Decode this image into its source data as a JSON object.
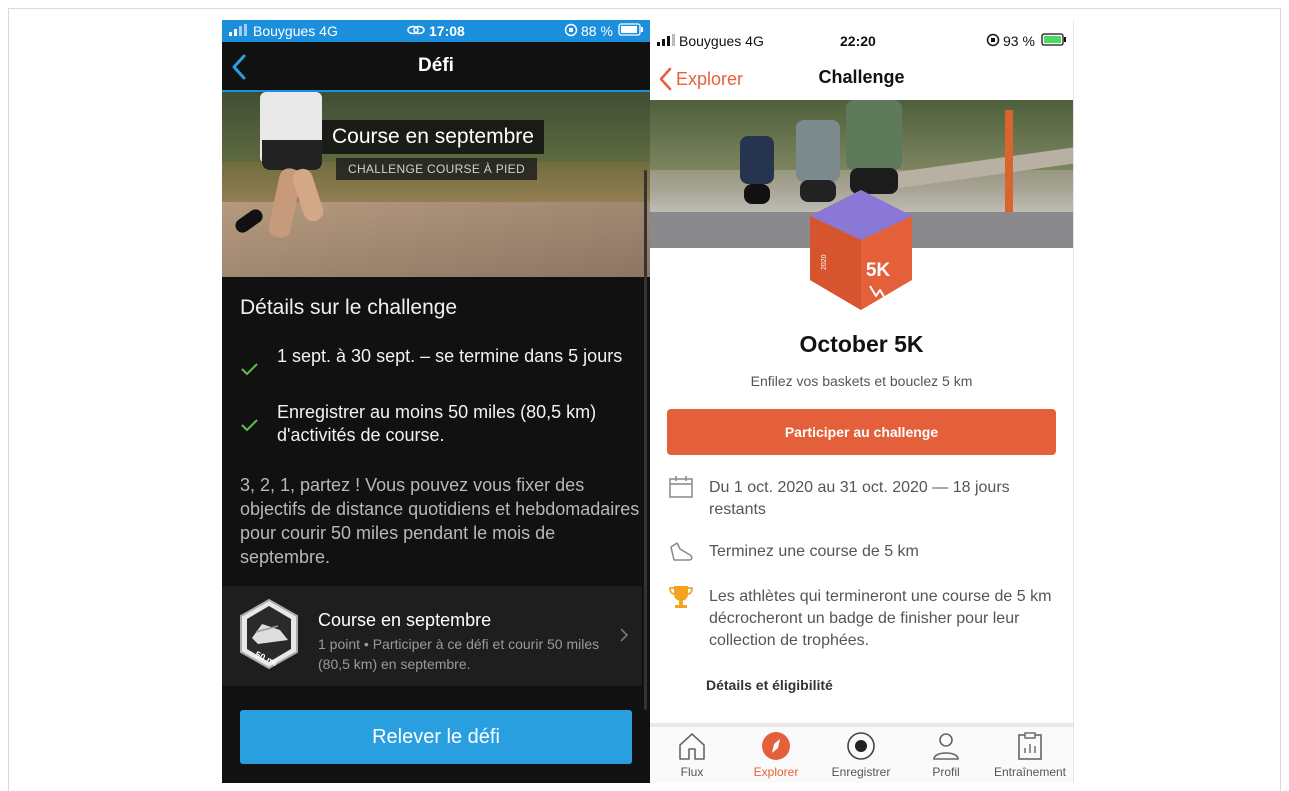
{
  "left_app": {
    "status": {
      "carrier": "Bouygues 4G",
      "time": "17:08",
      "battery": "88 %"
    },
    "header": {
      "title": "Défi",
      "back_icon": "chevron-left-icon"
    },
    "hero": {
      "title": "Course en septembre",
      "tag": "CHALLENGE COURSE À PIED"
    },
    "details_title": "Détails sur le challenge",
    "details_items": [
      {
        "text": "1 sept. à 30 sept. – se termine dans 5 jours",
        "icon": "check-icon"
      },
      {
        "text": "Enregistrer au moins 50 miles (80,5 km) d'activités de course.",
        "icon": "check-icon"
      }
    ],
    "description": "3, 2, 1, partez ! Vous pouvez vous fixer des objectifs de distance quotidiens et hebdomadaires pour courir 50 miles pendant le mois de septembre.",
    "card": {
      "title": "Course en septembre",
      "subtitle": "1 point • Participer à ce défi et courir 50 miles (80,5 km) en septembre.",
      "badge_text": "50 mi"
    },
    "cta_label": "Relever le défi",
    "accent_color": "#2a9fe0"
  },
  "right_app": {
    "status": {
      "carrier": "Bouygues 4G",
      "time": "22:20",
      "battery": "93 %"
    },
    "header": {
      "back_label": "Explorer",
      "title": "Challenge"
    },
    "badge": {
      "label": "5K",
      "year": "2020"
    },
    "challenge_name": "October 5K",
    "tagline": "Enfilez vos baskets et bouclez 5 km",
    "join_label": "Participer au challenge",
    "info_rows": [
      {
        "icon": "calendar-icon",
        "text": "Du 1 oct. 2020 au 31 oct. 2020 — 18 jours restants"
      },
      {
        "icon": "shoe-icon",
        "text": "Terminez une course de 5 km"
      },
      {
        "icon": "trophy-icon",
        "text": "Les athlètes qui termineront une course de 5 km décrocheront un badge de finisher pour leur collection de trophées."
      }
    ],
    "details_link": "Détails et éligibilité",
    "tabs": [
      {
        "label": "Flux",
        "icon": "home-icon",
        "active": false
      },
      {
        "label": "Explorer",
        "icon": "compass-icon",
        "active": true
      },
      {
        "label": "Enregistrer",
        "icon": "record-icon",
        "active": false
      },
      {
        "label": "Profil",
        "icon": "profile-icon",
        "active": false
      },
      {
        "label": "Entraînement",
        "icon": "training-icon",
        "active": false
      }
    ],
    "accent_color": "#e4603b"
  }
}
